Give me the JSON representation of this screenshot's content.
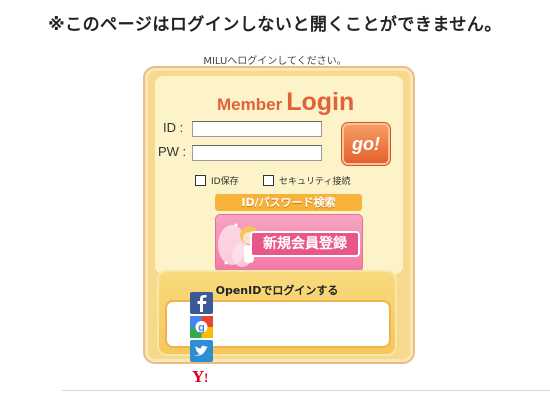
{
  "notice": "※このページはログインしないと開くことができません。",
  "prompt": "MILUへログインしてください。",
  "login": {
    "title_member": "Member",
    "title_login": "Login",
    "id_label": "ID :",
    "pw_label": "PW :",
    "id_value": "",
    "pw_value": "",
    "go_label": "go!",
    "save_id_label": "ID保存",
    "security_label": "セキュリティ接続",
    "search_button": "ID/パスワード検索",
    "register_button": "新規会員登録"
  },
  "openid": {
    "title": "OpenIDでログインする",
    "providers": [
      "facebook",
      "google",
      "twitter",
      "yahoo"
    ]
  },
  "colors": {
    "accent": "#e2613a",
    "panel": "#f6d98d",
    "pink": "#f27aa6"
  }
}
